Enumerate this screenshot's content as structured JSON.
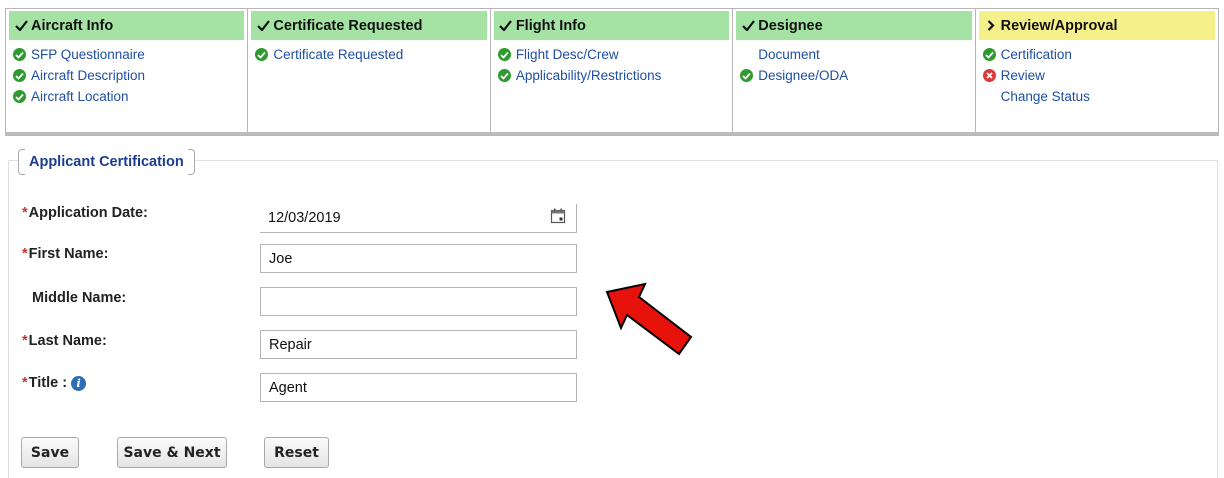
{
  "steps": [
    {
      "title": "Aircraft Info",
      "state": "done",
      "items": [
        {
          "label": "SFP Questionnaire",
          "status": "ok"
        },
        {
          "label": "Aircraft Description",
          "status": "ok"
        },
        {
          "label": "Aircraft Location",
          "status": "ok"
        }
      ]
    },
    {
      "title": "Certificate Requested",
      "state": "done",
      "items": [
        {
          "label": "Certificate Requested",
          "status": "ok"
        }
      ]
    },
    {
      "title": "Flight Info",
      "state": "done",
      "items": [
        {
          "label": "Flight Desc/Crew",
          "status": "ok"
        },
        {
          "label": "Applicability/Restrictions",
          "status": "ok"
        }
      ]
    },
    {
      "title": "Designee",
      "state": "done",
      "items": [
        {
          "label": "Document",
          "status": "none"
        },
        {
          "label": "Designee/ODA",
          "status": "ok"
        }
      ]
    },
    {
      "title": "Review/Approval",
      "state": "current",
      "items": [
        {
          "label": "Certification",
          "status": "ok"
        },
        {
          "label": "Review",
          "status": "error"
        },
        {
          "label": "Change Status",
          "status": "none"
        }
      ]
    }
  ],
  "section": {
    "title": "Applicant Certification"
  },
  "form": {
    "required_mark": "*",
    "application_date": {
      "label": "Application Date:",
      "value": "12/03/2019"
    },
    "first_name": {
      "label": "First Name:",
      "value": "Joe"
    },
    "middle_name": {
      "label": "Middle Name:",
      "value": ""
    },
    "last_name": {
      "label": "Last Name:",
      "value": "Repair"
    },
    "title": {
      "label": "Title :",
      "value": "Agent"
    }
  },
  "buttons": {
    "save": "Save",
    "save_next": "Save & Next",
    "reset": "Reset"
  },
  "colors": {
    "step_done": "#a5e3a5",
    "step_current": "#f5f08a",
    "link": "#1f4fa3",
    "ok": "#2f9a2f",
    "error": "#d93a3a",
    "arrow": "#e8120c"
  },
  "icons": {
    "info": "i"
  }
}
